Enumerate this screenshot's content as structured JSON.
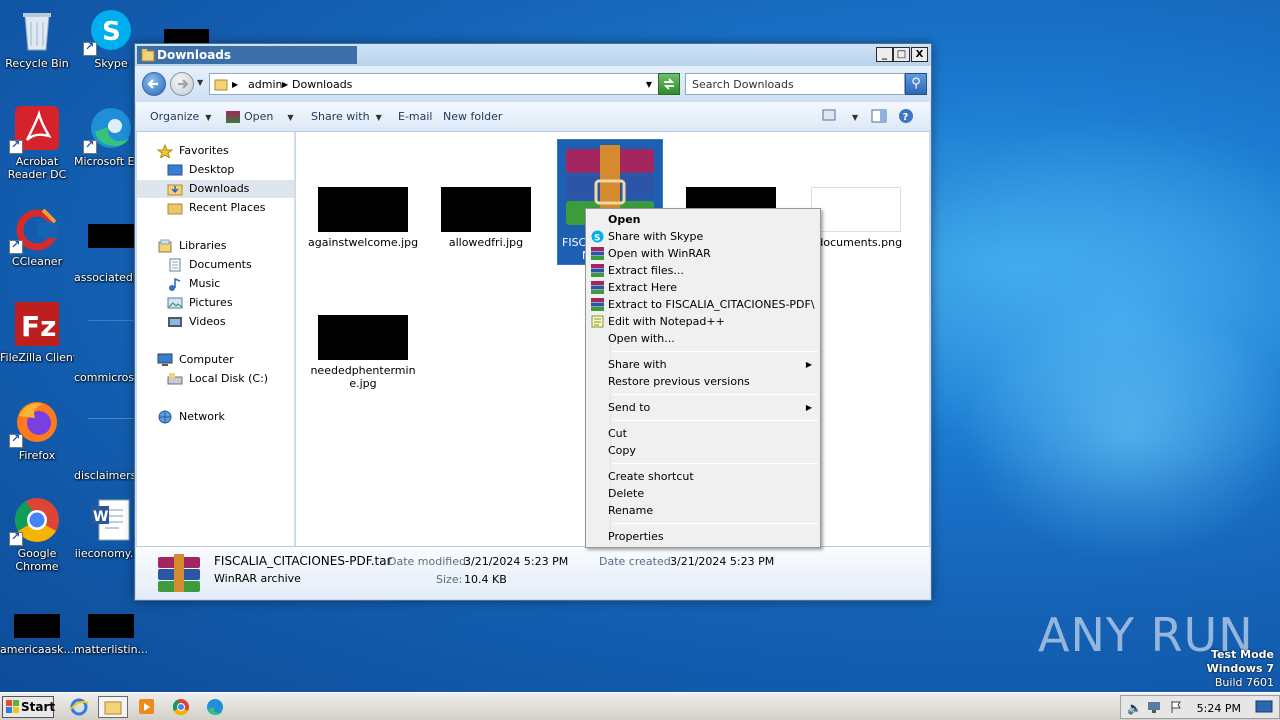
{
  "desktop": {
    "icons": [
      {
        "label": "Recycle Bin"
      },
      {
        "label": "Skype"
      },
      {
        "label": "Acrobat Reader DC"
      },
      {
        "label": "Microsoft Edge"
      },
      {
        "label": "CCleaner"
      },
      {
        "label": "associatedb..."
      },
      {
        "label": "FileZilla Client"
      },
      {
        "label": "commicroso..."
      },
      {
        "label": "Firefox"
      },
      {
        "label": "disclaimersu..."
      },
      {
        "label": "Google Chrome"
      },
      {
        "label": "iieconomy.r..."
      },
      {
        "label": "americaask..."
      },
      {
        "label": "matterlistin..."
      }
    ]
  },
  "window": {
    "title": "Downloads",
    "min_label": "_",
    "max_label": "□",
    "close_label": "X",
    "address": {
      "crumb1": "admin",
      "crumb2": "Downloads"
    },
    "search_placeholder": "Search Downloads",
    "toolbar": {
      "organize": "Organize",
      "open": "Open",
      "share_with": "Share with",
      "email": "E-mail",
      "new_folder": "New folder"
    },
    "nav": {
      "favorites": "Favorites",
      "desktop": "Desktop",
      "downloads": "Downloads",
      "recent_places": "Recent Places",
      "libraries": "Libraries",
      "documents": "Documents",
      "music": "Music",
      "pictures": "Pictures",
      "videos": "Videos",
      "computer": "Computer",
      "local_disk": "Local Disk (C:)",
      "network": "Network"
    },
    "files": [
      {
        "name": "againstwelcome.jpg"
      },
      {
        "name": "allowedfri.jpg"
      },
      {
        "name": "FISCALIA_CITACIONES-PDF.tar",
        "short": "FISC",
        "short2": "N"
      },
      {
        "name": ""
      },
      {
        "name": "vdocuments.png"
      },
      {
        "name": "neededphentermine.jpg",
        "line1": "neededphentermin",
        "line2": "e.jpg"
      }
    ],
    "details": {
      "filename": "FISCALIA_CITACIONES-PDF.tar",
      "type": "WinRAR archive",
      "date_modified_label": "Date modified:",
      "date_modified": "3/21/2024 5:23 PM",
      "date_created_label": "Date created:",
      "date_created": "3/21/2024 5:23 PM",
      "size_label": "Size:",
      "size": "10.4 KB"
    }
  },
  "context_menu": {
    "items": [
      {
        "label": "Open"
      },
      {
        "label": "Share with Skype"
      },
      {
        "label": "Open with WinRAR"
      },
      {
        "label": "Extract files..."
      },
      {
        "label": "Extract Here"
      },
      {
        "label": "Extract to FISCALIA_CITACIONES-PDF\\"
      },
      {
        "label": "Edit with Notepad++"
      },
      {
        "label": "Open with..."
      },
      {
        "label": "Share with"
      },
      {
        "label": "Restore previous versions"
      },
      {
        "label": "Send to"
      },
      {
        "label": "Cut"
      },
      {
        "label": "Copy"
      },
      {
        "label": "Create shortcut"
      },
      {
        "label": "Delete"
      },
      {
        "label": "Rename"
      },
      {
        "label": "Properties"
      }
    ]
  },
  "taskbar": {
    "start": "Start",
    "clock": "5:24 PM"
  },
  "watermark": {
    "brand": "ANY RUN",
    "line1": "Test Mode",
    "line2": "Windows 7",
    "line3": "Build 7601"
  },
  "colors": {
    "desktop_bg": "#1763b3",
    "selection": "#1d5fb0",
    "winrar_red": "#c0282c"
  }
}
